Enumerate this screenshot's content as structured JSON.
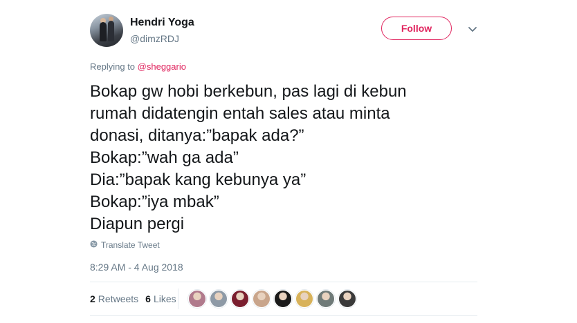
{
  "user": {
    "name": "Hendri Yoga",
    "handle": "@dimzRDJ"
  },
  "follow_label": "Follow",
  "reply": {
    "prefix": "Replying to ",
    "mention": "@sheggario"
  },
  "tweet": {
    "text": "Bokap gw hobi berkebun, pas lagi di kebun\nrumah didatengin entah sales atau minta\ndonasi, ditanya:”bapak ada?”\nBokap:”wah ga ada”\nDia:”bapak kang kebunya ya”\nBokap:”iya mbak”\nDiapun pergi",
    "translate_label": "Translate Tweet",
    "timestamp": "8:29 AM - 4 Aug 2018"
  },
  "stats": {
    "retweets_count": "2",
    "retweets_label": "Retweets",
    "likes_count": "6",
    "likes_label": "Likes"
  },
  "likers": [
    {
      "color": "#b07a8c"
    },
    {
      "color": "#8e9aa6"
    },
    {
      "color": "#7a1e2e"
    },
    {
      "color": "#c9a58b"
    },
    {
      "color": "#1a1a1a"
    },
    {
      "color": "#d8b25a"
    },
    {
      "color": "#6f7a78"
    },
    {
      "color": "#3a3a3a"
    }
  ],
  "colors": {
    "accent": "#e0245e",
    "secondary_text": "#657786",
    "primary_text": "#14171a",
    "divider": "#e6ecf0"
  }
}
